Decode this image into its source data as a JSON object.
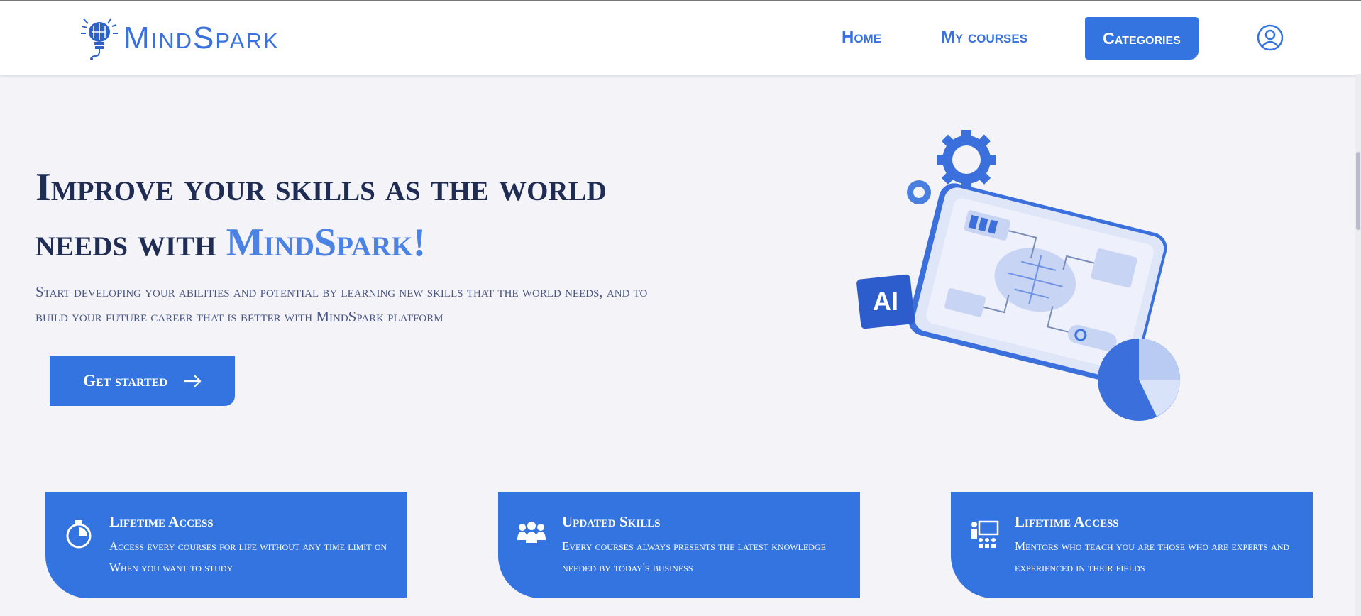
{
  "brand": {
    "name": "MindSpark",
    "accent": "#3474e0"
  },
  "nav": {
    "home": "Home",
    "my_courses": "My courses",
    "categories": "Categories",
    "user_icon": "user-circle-icon"
  },
  "hero": {
    "title_part1": "Improve your skills as the world needs with ",
    "title_brand": "MindSpark!",
    "subtitle": "Start developing your abilities and potential by learning new skills that the world needs, and to build your future career that is better with MindSpark platform",
    "cta": "Get started",
    "illustration_badge": "AI"
  },
  "features": [
    {
      "icon": "stopwatch-icon",
      "title": "Lifetime Access",
      "description": "Access every courses for life without any time limit on When you want to study"
    },
    {
      "icon": "people-group-icon",
      "title": "Updated Skills",
      "description": "Every courses always presents the latest knowledge needed by today's business"
    },
    {
      "icon": "presenter-icon",
      "title": "Lifetime Access",
      "description": "Mentors who teach you are those who are experts and experienced in their fields"
    }
  ]
}
